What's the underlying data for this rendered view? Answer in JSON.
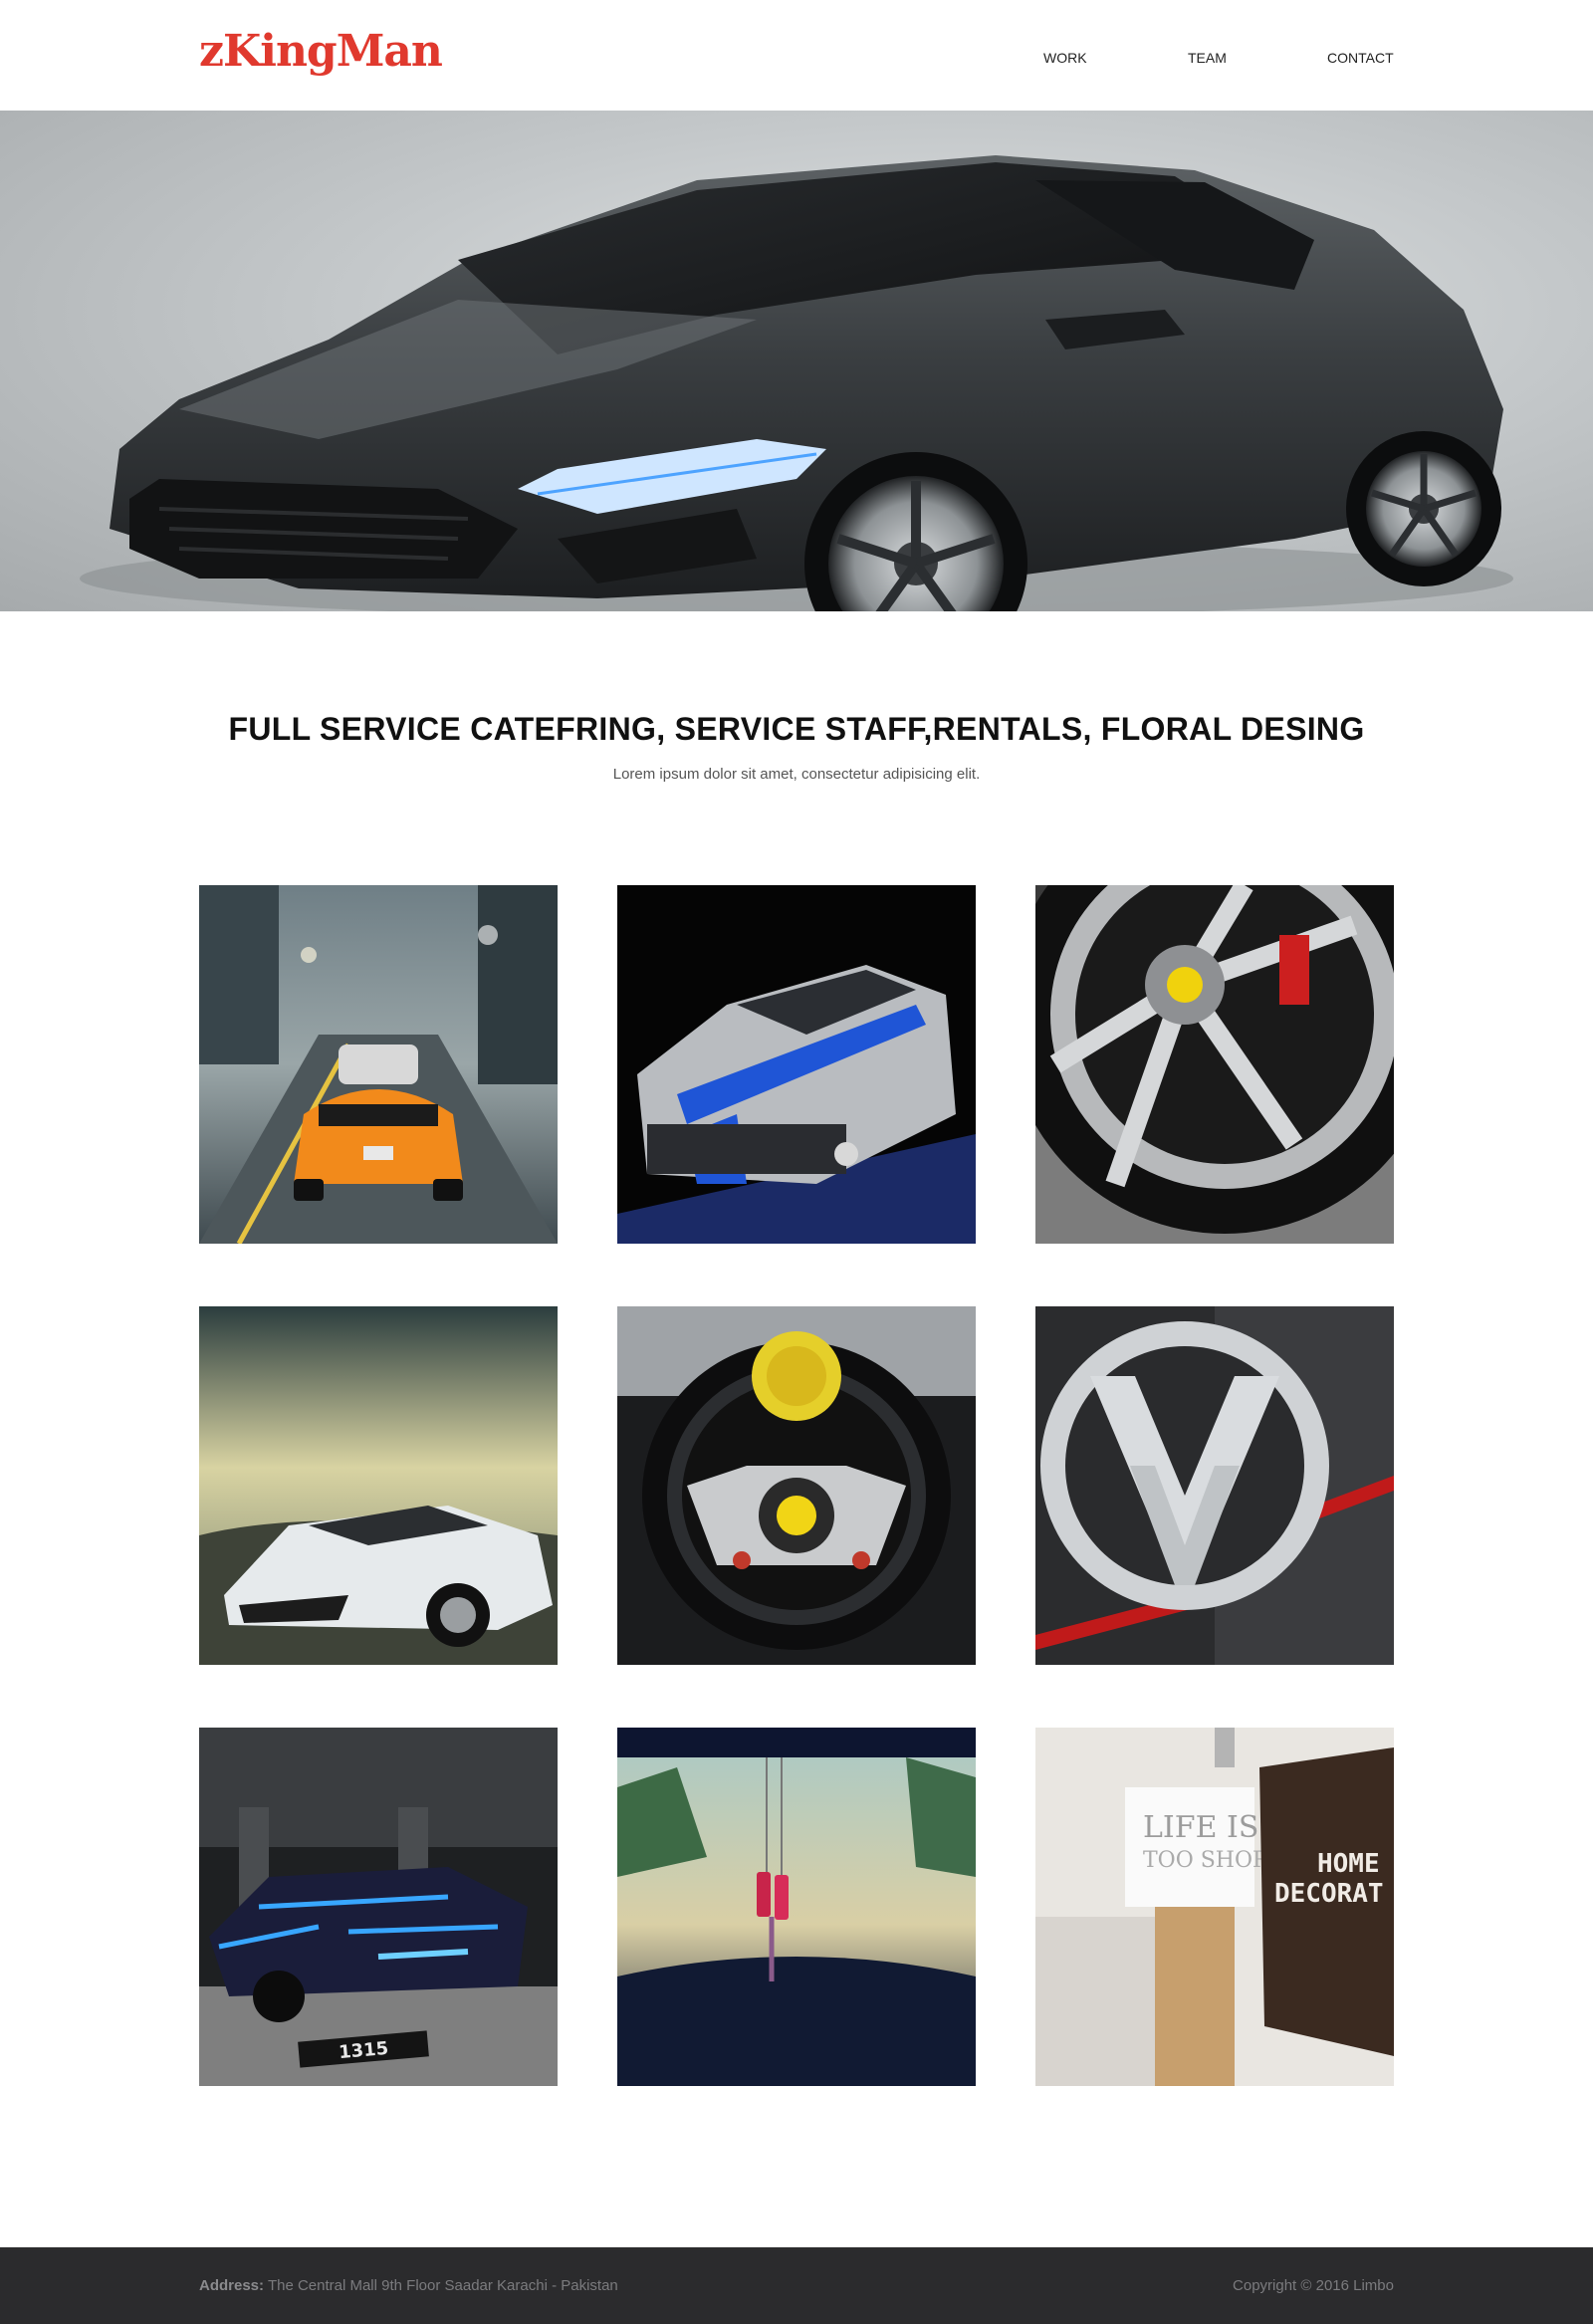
{
  "brand": {
    "logo_text": "zKingMan",
    "accent": "#e0392e"
  },
  "nav": {
    "items": [
      "WORK",
      "TEAM",
      "CONTACT"
    ]
  },
  "intro": {
    "title": "FULL SERVICE CATEFRING, SERVICE STAFF,RENTALS, FLORAL DESING",
    "subtitle": "Lorem ipsum dolor sit amet, consectetur adipisicing elit."
  },
  "gallery": {
    "tiles": [
      {
        "name": "orange-supercar-street-photo"
      },
      {
        "name": "striped-muscle-car-photo"
      },
      {
        "name": "alloy-wheel-closeup-photo"
      },
      {
        "name": "white-lamborghini-photo"
      },
      {
        "name": "steering-wheel-photo"
      },
      {
        "name": "vw-emblem-photo"
      },
      {
        "name": "neon-car-parking-photo"
      },
      {
        "name": "rearview-charm-photo"
      },
      {
        "name": "home-decor-signs-photo"
      }
    ],
    "home_sign_line1": "HOME",
    "home_sign_line2": "DECORAT",
    "life_sign": "LIFE IS",
    "too_short": "TOO SHORT",
    "plate": "1315"
  },
  "footer": {
    "address_label": "Address:",
    "address_text": "The Central Mall 9th Floor Saadar Karachi - Pakistan",
    "copyright": "Copyright © 2016 Limbo",
    "bg": "#2b2b2d"
  }
}
